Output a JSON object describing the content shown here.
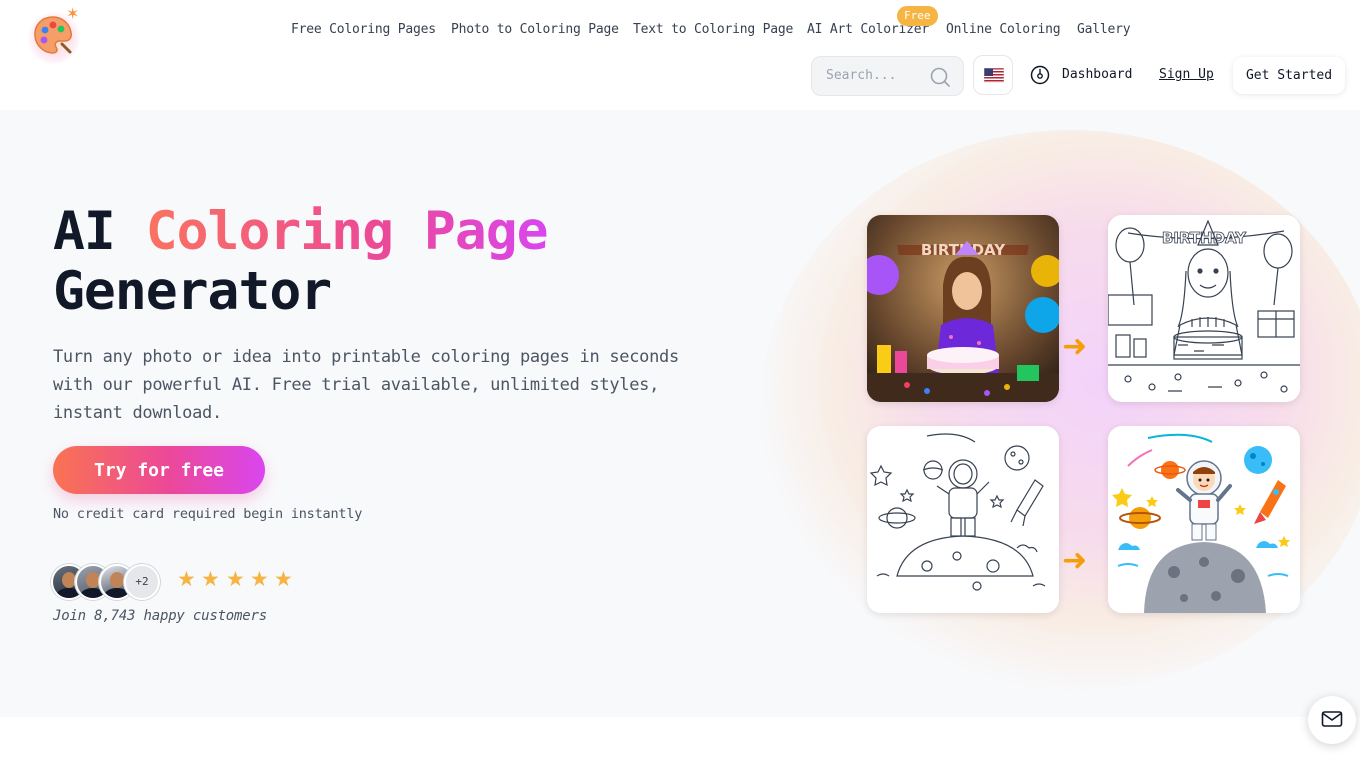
{
  "colors": {
    "accent_orange": "#f97360",
    "accent_pink": "#ec4899",
    "accent_purple": "#d946ef",
    "badge_yellow": "#f6b443",
    "hero_bg": "#f8f9fb"
  },
  "header": {
    "logo_icon": "palette-icon",
    "nav": {
      "free_coloring_pages": "Free Coloring Pages",
      "photo_to_coloring_page": "Photo to Coloring Page",
      "text_to_coloring_page": "Text to Coloring Page",
      "ai_art_colorizer": "AI Art Colorizer",
      "ai_art_colorizer_badge": "Free",
      "online_coloring": "Online Coloring",
      "gallery": "Gallery"
    },
    "search": {
      "placeholder": "Search..."
    },
    "language_icon": "us-flag-icon",
    "dashboard_label": "Dashboard",
    "sign_up_label": "Sign Up",
    "get_started_label": "Get Started"
  },
  "hero": {
    "title_plain_1": "AI ",
    "title_highlight": "Coloring Page",
    "title_plain_2": "Generator",
    "subtitle": "Turn any photo or idea into printable coloring pages in seconds with our powerful AI. Free trial available, unlimited styles, instant download.",
    "cta_label": "Try for free",
    "cta_note": "No credit card required begin instantly",
    "avatars_more": "+2",
    "rating_stars": 5,
    "join_text": "Join 8,743 happy customers",
    "showcase_banner_text": "BIRTHDAY",
    "showcase": [
      {
        "name": "birthday-photo",
        "kind": "photo"
      },
      {
        "name": "birthday-coloring-page",
        "kind": "line-art"
      },
      {
        "name": "astronaut-line-art",
        "kind": "line-art"
      },
      {
        "name": "astronaut-colored",
        "kind": "colored"
      }
    ]
  },
  "chat_icon": "mail-chat-icon"
}
